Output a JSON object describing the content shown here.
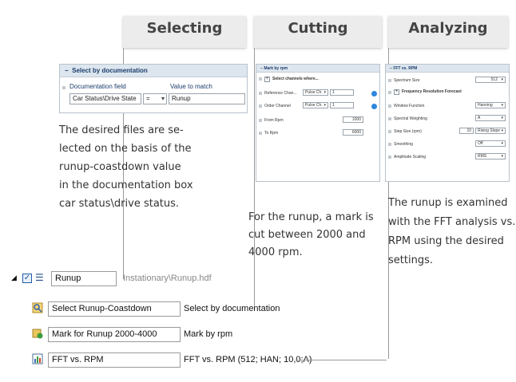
{
  "columns": {
    "selecting": "Selecting",
    "cutting": "Cutting",
    "analyzing": "Analyzing"
  },
  "select_panel": {
    "title": "Select by documentation",
    "col_field": "Documentation field",
    "col_value": "Value to match",
    "field_value": "Car Status\\Drive State",
    "operator": "=",
    "match_value": "Runup"
  },
  "rpm_panel": {
    "title": "Mark by rpm",
    "select_channels": "Select channels where...",
    "ref_channel_label": "Reference Chan...",
    "ref_channel_value": "Pulse Ch.",
    "ref_channel_num": "1",
    "order_channel_label": "Order Channel",
    "order_channel_value": "Pulse Ch.",
    "order_channel_num": "1",
    "from_label": "From Rpm",
    "from_value": "1000",
    "to_label": "To Rpm",
    "to_value": "6000"
  },
  "fft_panel": {
    "title": "FFT vs. RPM",
    "spectrum_size_label": "Spectrum Size",
    "spectrum_size_value": "512",
    "freq_res": "Frequency Resolution Forecast",
    "window_label": "Window Function",
    "window_value": "Hanning",
    "weighting_label": "Spectral Weighting",
    "weighting_value": "A",
    "step_label": "Step Size (rpm)",
    "step_value": "10",
    "step_mode": "Rising Slope",
    "smoothing_label": "Smoothing",
    "smoothing_value": "Off",
    "amp_label": "Amplitude Scaling",
    "amp_value": "RMS"
  },
  "descriptions": {
    "selecting": [
      "The desired files are se-",
      "lected on the basis of the",
      "runup-coastdown value",
      "in the documentation box",
      "car status\\drive status."
    ],
    "cutting": [
      "For the runup, a mark is",
      "cut between 2000 and",
      "4000 rpm."
    ],
    "analyzing": [
      "The runup is examined",
      "with the FFT analysis vs.",
      "RPM using the desired",
      "settings."
    ]
  },
  "tree": {
    "root_name": "Runup",
    "root_path": "Instationary\\Runup.hdf",
    "items": [
      {
        "name": "Select Runup-Coastdown",
        "desc": "Select by documentation"
      },
      {
        "name": "Mark for Runup 2000-4000",
        "desc": "Mark by rpm"
      },
      {
        "name": "FFT vs. RPM",
        "desc": "FFT vs. RPM (512; HAN; 10,0;A)"
      }
    ]
  }
}
